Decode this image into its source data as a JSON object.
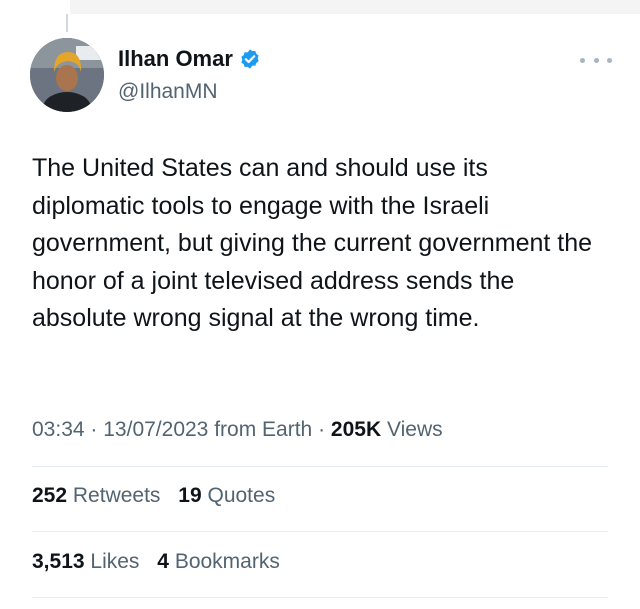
{
  "author": {
    "display_name": "Ilhan Omar",
    "handle": "@IlhanMN",
    "verified": true
  },
  "tweet": {
    "text": "The United States can and should use its diplomatic tools to engage with the Israeli government, but giving the current government the honor of a joint televised address sends the absolute wrong signal at the wrong time."
  },
  "meta": {
    "time": "03:34",
    "separator": "·",
    "date": "13/07/2023",
    "source": "from Earth",
    "views_count": "205K",
    "views_label": "Views"
  },
  "stats": {
    "retweets_count": "252",
    "retweets_label": "Retweets",
    "quotes_count": "19",
    "quotes_label": "Quotes",
    "likes_count": "3,513",
    "likes_label": "Likes",
    "bookmarks_count": "4",
    "bookmarks_label": "Bookmarks"
  },
  "colors": {
    "text": "#0f1419",
    "secondary": "#536471",
    "verified": "#1d9bf0",
    "divider": "#e6ecf0"
  },
  "icons": {
    "verified": "verified-badge-icon",
    "more": "more-options-icon"
  }
}
